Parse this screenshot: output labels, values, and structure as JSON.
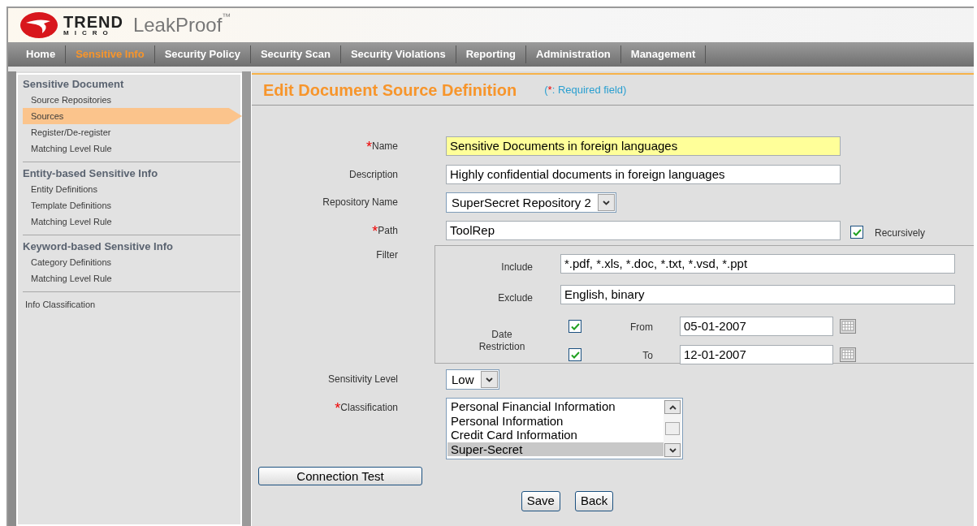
{
  "header": {
    "brand_top": "TREND",
    "brand_bottom": "MICRO",
    "product": "LeakProof",
    "trademark": "™"
  },
  "nav": [
    {
      "label": "Home",
      "selected": false
    },
    {
      "label": "Sensitive Info",
      "selected": true
    },
    {
      "label": "Security Policy",
      "selected": false
    },
    {
      "label": "Security Scan",
      "selected": false
    },
    {
      "label": "Security Violations",
      "selected": false
    },
    {
      "label": "Reporting",
      "selected": false
    },
    {
      "label": "Administration",
      "selected": false
    },
    {
      "label": "Management",
      "selected": false
    }
  ],
  "sidebar": [
    {
      "title": "Sensitive Document",
      "items": [
        {
          "label": "Source Repositories",
          "selected": false
        },
        {
          "label": "Sources",
          "selected": true
        },
        {
          "label": "Register/De-register",
          "selected": false
        },
        {
          "label": "Matching Level Rule",
          "selected": false
        }
      ]
    },
    {
      "title": "Entity-based Sensitive Info",
      "items": [
        {
          "label": "Entity Definitions",
          "selected": false
        },
        {
          "label": "Template Definitions",
          "selected": false
        },
        {
          "label": "Matching Level Rule",
          "selected": false
        }
      ]
    },
    {
      "title": "Keyword-based Sensitive Info",
      "items": [
        {
          "label": "Category Definitions",
          "selected": false
        },
        {
          "label": "Matching Level Rule",
          "selected": false
        }
      ]
    },
    {
      "items": [
        {
          "label": "Info Classification",
          "selected": false
        }
      ]
    }
  ],
  "form": {
    "title": "Edit Document Source Definition",
    "hint": {
      "open": "(",
      "mark": "*",
      "text": ": Required field)"
    },
    "fields": [
      {
        "kind": "text",
        "label": "Name",
        "required_mark": "*",
        "value": "Sensitive Documents in foreign languages",
        "highlighted": true
      },
      {
        "kind": "text",
        "label": "Description",
        "value": "Highly confidential documents in foreign languages",
        "highlighted": false
      },
      {
        "kind": "select",
        "label": "Repository Name",
        "value": "SuperSecret Repository 2"
      },
      {
        "kind": "path",
        "label": "Path",
        "required_mark": "*",
        "value": "ToolRep",
        "option": {
          "label": "Recursively",
          "checked": true
        }
      },
      {
        "kind": "filter",
        "label": "Filter",
        "include": {
          "label": "Include",
          "value": "*.pdf, *.xls, *.doc, *.txt, *.vsd, *.ppt"
        },
        "exclude": {
          "label": "Exclude",
          "value": "English, binary"
        },
        "date": {
          "label": "Date Restriction",
          "from": {
            "label": "From",
            "checked": true,
            "value": "05-01-2007"
          },
          "to": {
            "label": "To",
            "checked": true,
            "value": "12-01-2007"
          }
        }
      },
      {
        "kind": "select",
        "label": "Sensitivity Level",
        "value": "Low"
      },
      {
        "kind": "list",
        "label": "Classification",
        "required_mark": "*",
        "options": [
          {
            "label": "Personal Financial Information",
            "selected": false
          },
          {
            "label": "Personal Information",
            "selected": false
          },
          {
            "label": "Credit Card Information",
            "selected": false
          },
          {
            "label": "Super-Secret",
            "selected": true
          }
        ]
      }
    ],
    "test_button": "Connection Test",
    "actions": [
      "Save",
      "Back"
    ]
  }
}
